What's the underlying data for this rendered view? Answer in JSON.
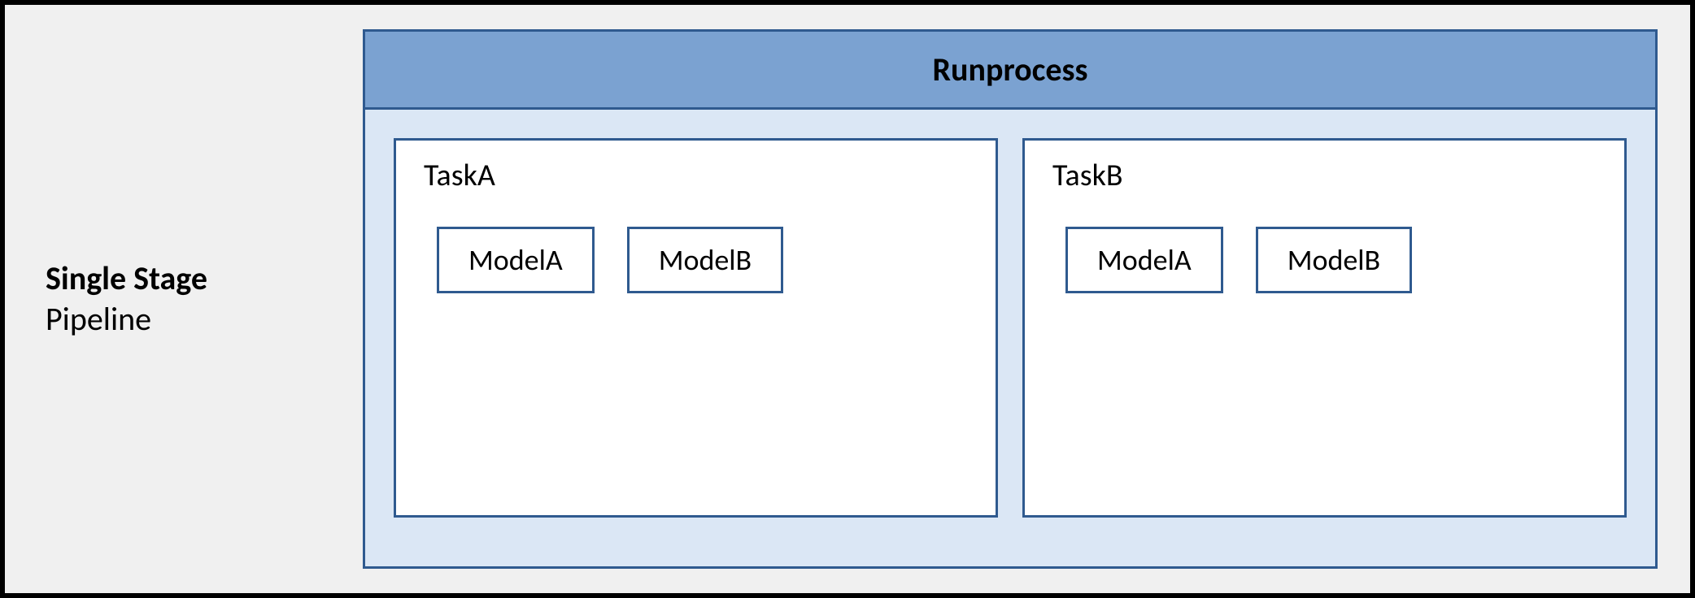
{
  "label": {
    "line1": "Single Stage",
    "line2": "Pipeline"
  },
  "runprocess": {
    "title": "Runprocess",
    "tasks": [
      {
        "name": "TaskA",
        "models": [
          "ModelA",
          "ModelB"
        ]
      },
      {
        "name": "TaskB",
        "models": [
          "ModelA",
          "ModelB"
        ]
      }
    ]
  }
}
